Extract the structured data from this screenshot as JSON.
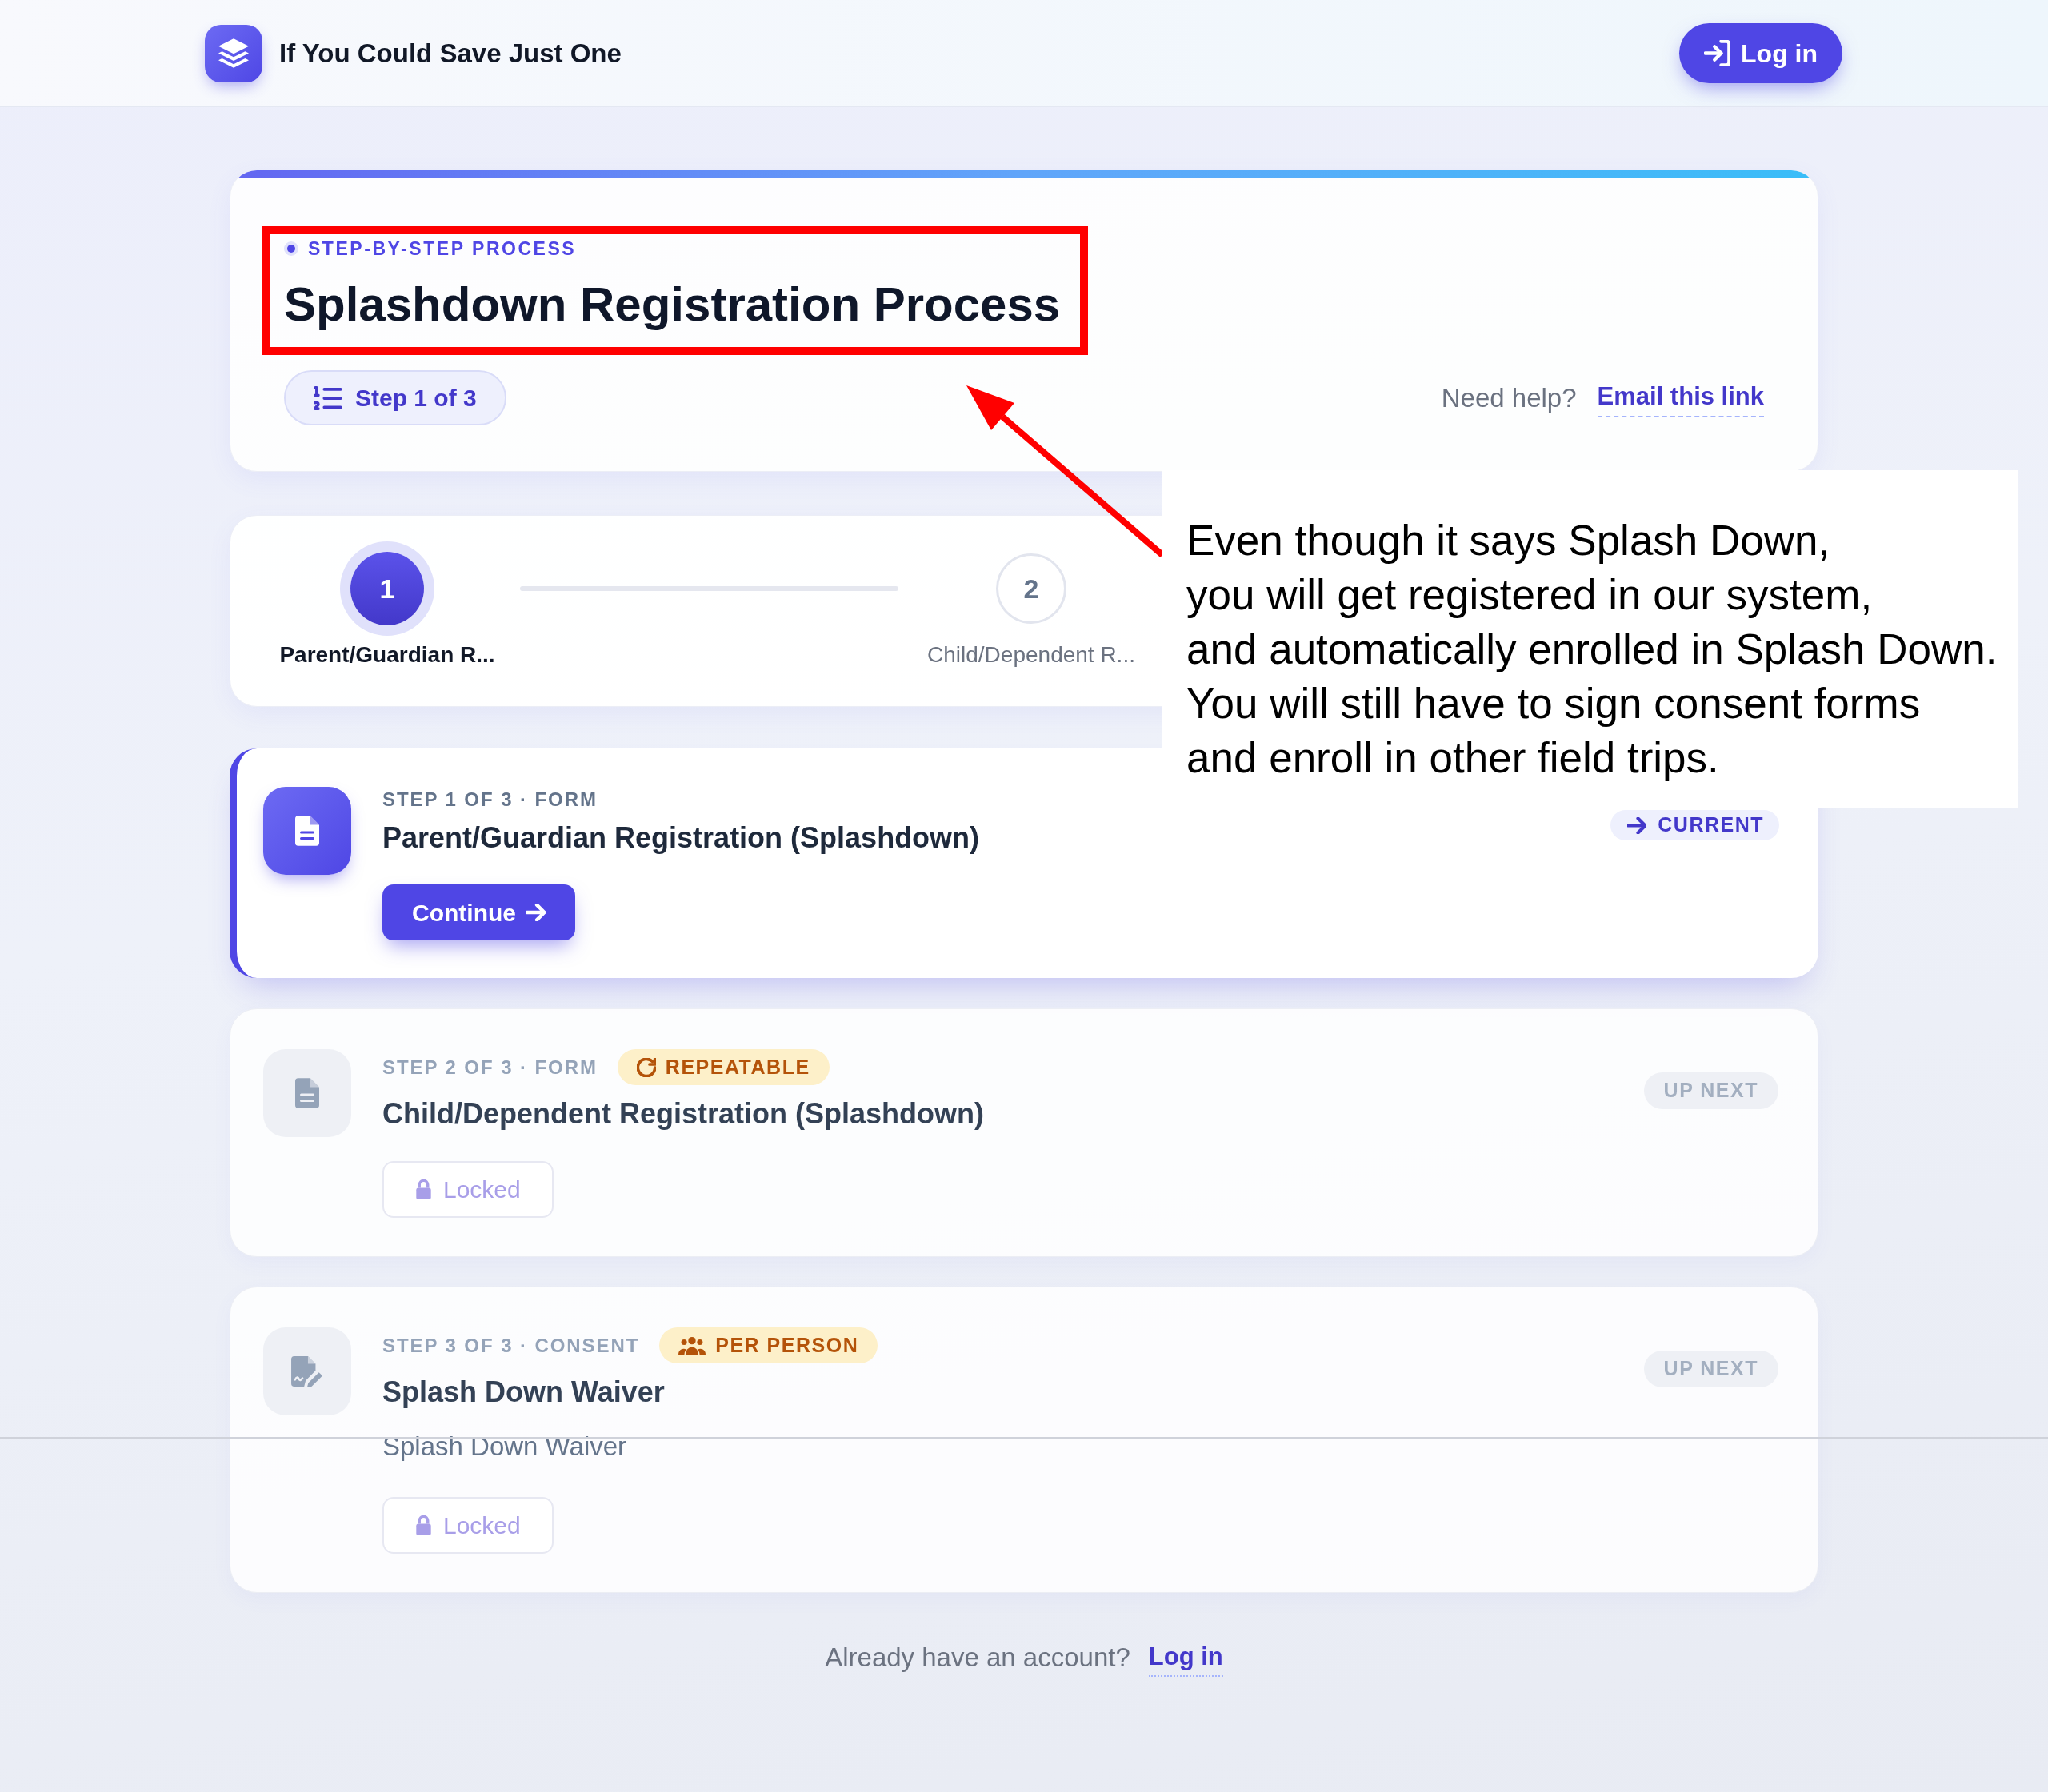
{
  "header": {
    "brand": "If You Could Save Just One",
    "login_button": "Log in"
  },
  "intro": {
    "eyebrow": "STEP-BY-STEP PROCESS",
    "title": "Splashdown Registration Process",
    "step_pill": "Step 1 of 3",
    "help_text": "Need help?",
    "help_link": "Email this link"
  },
  "stepper": [
    {
      "number": "1",
      "label": "Parent/Guardian R...",
      "selected": true
    },
    {
      "number": "2",
      "label": "Child/Dependent R...",
      "selected": false
    }
  ],
  "steps": [
    {
      "kind": "form",
      "current": true,
      "eyebrow": "STEP 1 OF 3 · FORM",
      "title": "Parent/Guardian Registration (Splashdown)",
      "status": "CURRENT",
      "action": "Continue"
    },
    {
      "kind": "form",
      "current": false,
      "eyebrow": "STEP 2 OF 3 · FORM",
      "tag": {
        "kind": "repeatable",
        "label": "REPEATABLE"
      },
      "title": "Child/Dependent Registration (Splashdown)",
      "status": "UP NEXT",
      "action": "Locked"
    },
    {
      "kind": "consent",
      "current": false,
      "eyebrow": "STEP 3 OF 3 · CONSENT",
      "tag": {
        "kind": "per_person",
        "label": "PER PERSON"
      },
      "title": "Splash Down Waiver",
      "description": "Splash Down Waiver",
      "status": "UP NEXT",
      "action": "Locked"
    }
  ],
  "footer": {
    "text": "Already have an account?",
    "link": "Log in"
  },
  "annotation": {
    "lines": [
      "Even though it says Splash Down,",
      "you will get registered in our system,",
      "and automatically enrolled in Splash Down.",
      "You will still have to sign consent forms",
      "and enroll in other field trips."
    ]
  }
}
